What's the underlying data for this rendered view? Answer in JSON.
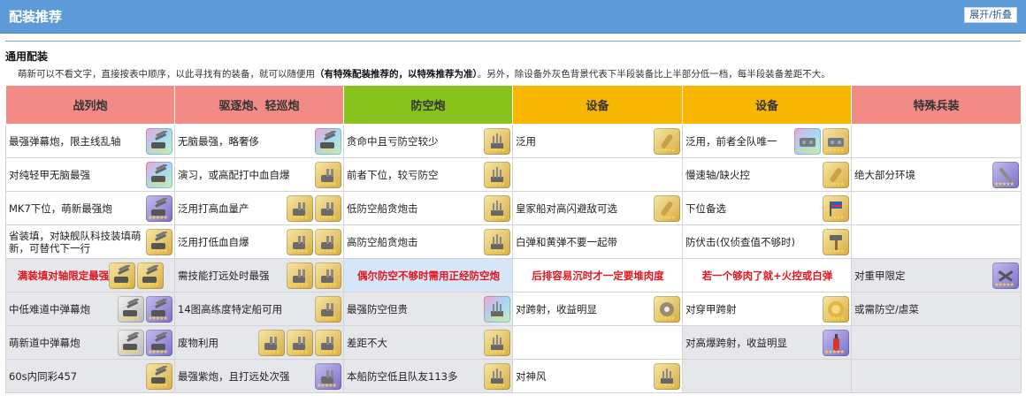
{
  "header": {
    "title": "配装推荐",
    "toggle_label": "展开/折叠"
  },
  "section": {
    "title": "通用配装",
    "notice_prefix": "萌新可以不看文字，直接按表中顺序，以此寻找有的装备，就可以随便用",
    "notice_bold": "（有特殊配装推荐的，以特殊推荐为准）",
    "notice_suffix": "。另外，除设备外灰色背景代表下半段装备比上半部分低一档，每半段装备差距不大。"
  },
  "columns": [
    "战列炮",
    "驱逐炮、轻巡炮",
    "防空炮",
    "设备",
    "设备",
    "特殊兵装"
  ],
  "colors": {
    "header_bar": "#5d9bd8",
    "red_head": "#f28b86",
    "green_head": "#87c21d",
    "orange_head": "#f7b600",
    "highlight_text": "#e0161e",
    "lower_rows": "#e6e7ea"
  },
  "rows": [
    {
      "cells": [
        {
          "text": "最强弹幕炮，限主线乱轴",
          "icons": [
            {
              "name": "heavy-gun-icon",
              "tier": "rainbow"
            }
          ]
        },
        {
          "text": "无脑最强，略奢侈",
          "icons": [
            {
              "name": "heavy-gun-icon",
              "tier": "rainbow"
            }
          ]
        },
        {
          "text": "贪命中且亏防空较少",
          "icons": [
            {
              "name": "aa-gun-icon",
              "tier": "gold"
            }
          ]
        },
        {
          "text": "泛用",
          "icons": [
            {
              "name": "shell-icon",
              "tier": "gold"
            }
          ]
        },
        {
          "text": "泛用，前者全队唯一",
          "icons": [
            {
              "name": "machine-icon",
              "tier": "rainbow"
            },
            {
              "name": "machine-icon",
              "tier": "gold"
            }
          ]
        },
        {
          "text": "",
          "icons": []
        }
      ]
    },
    {
      "cells": [
        {
          "text": "对纯轻甲无脑最强",
          "icons": [
            {
              "name": "heavy-gun-icon",
              "tier": "rainbow"
            }
          ]
        },
        {
          "text": "演习，或高配打中血自爆",
          "icons": [
            {
              "name": "gun-turret-icon",
              "tier": "gold"
            }
          ]
        },
        {
          "text": "前者下位，较亏防空",
          "icons": [
            {
              "name": "aa-gun-icon",
              "tier": "gold"
            }
          ]
        },
        {
          "text": "",
          "icons": []
        },
        {
          "text": "慢速轴/缺火控",
          "icons": [
            {
              "name": "shell-icon",
              "tier": "gold"
            }
          ]
        },
        {
          "text": "绝大部分环境",
          "icons": [
            {
              "name": "torpedo-icon",
              "tier": "purple"
            }
          ]
        }
      ]
    },
    {
      "cells": [
        {
          "text": "MK7下位，萌新最强炮",
          "icons": [
            {
              "name": "heavy-gun-icon",
              "tier": "purple"
            }
          ]
        },
        {
          "text": "泛用打高血量产",
          "icons": [
            {
              "name": "gun-turret-icon",
              "tier": "gold"
            },
            {
              "name": "gun-turret-icon",
              "tier": "gold"
            }
          ]
        },
        {
          "text": "低防空船贪炮击",
          "icons": [
            {
              "name": "aa-gun-icon",
              "tier": "gold"
            }
          ]
        },
        {
          "text": "皇家船对高闪避敌可选",
          "icons": [
            {
              "name": "shell-icon",
              "tier": "gold"
            }
          ]
        },
        {
          "text": "下位备选",
          "icons": [
            {
              "name": "flag-icon",
              "tier": "gold"
            }
          ]
        },
        {
          "text": "",
          "icons": []
        }
      ]
    },
    {
      "cells": [
        {
          "text": "省装填，对缺舰队科技装填萌新，可替代下一行",
          "icons": [
            {
              "name": "heavy-gun-icon",
              "tier": "gold"
            }
          ]
        },
        {
          "text": "泛用打低血自爆",
          "icons": [
            {
              "name": "gun-turret-icon",
              "tier": "gold"
            },
            {
              "name": "gun-turret-icon",
              "tier": "gold"
            }
          ]
        },
        {
          "text": "高防空船贪炮击",
          "icons": [
            {
              "name": "aa-gun-icon",
              "tier": "gold"
            }
          ]
        },
        {
          "text": "白弹和黄弹不要一起带",
          "icons": []
        },
        {
          "text": "防伏击(仅侦查值不够时)",
          "icons": [
            {
              "name": "hammer-icon",
              "tier": "gold"
            }
          ]
        },
        {
          "text": "",
          "icons": []
        }
      ]
    },
    {
      "cells": [
        {
          "text": "满装填对轴限定最强",
          "red": true,
          "icons": [
            {
              "name": "heavy-gun-icon",
              "tier": "gold"
            },
            {
              "name": "heavy-gun-icon",
              "tier": "gold"
            }
          ]
        },
        {
          "text": "需技能打远处时最强",
          "icons": [
            {
              "name": "gun-turret-icon",
              "tier": "gold"
            },
            {
              "name": "gun-turret-icon",
              "tier": "gold"
            }
          ]
        },
        {
          "text": "偶尔防空不够时需用正经防空炮",
          "red": true,
          "icons": []
        },
        {
          "text": "后排容易沉时才一定要堆肉度",
          "red": true,
          "icons": []
        },
        {
          "text": "若一个够肉了就+火控或白弹",
          "red": true,
          "icons": []
        },
        {
          "text": "对重甲限定",
          "icons": [
            {
              "name": "plane-icon",
              "tier": "purple"
            }
          ]
        }
      ]
    },
    {
      "cells": [
        {
          "text": "中低难道中弹幕炮",
          "icons": [
            {
              "name": "heavy-gun-icon",
              "tier": "silver"
            },
            {
              "name": "heavy-gun-icon",
              "tier": "purple"
            }
          ]
        },
        {
          "text": "14图高练度特定船可用",
          "icons": [
            {
              "name": "gun-turret-icon",
              "tier": "gold"
            }
          ]
        },
        {
          "text": "最强防空但贵",
          "icons": [
            {
              "name": "aa-gun-icon",
              "tier": "rainbow"
            }
          ]
        },
        {
          "text": "对跨射，收益明显",
          "icons": [
            {
              "name": "gear-icon",
              "tier": "gold"
            }
          ]
        },
        {
          "text": "对穿甲跨射",
          "icons": [
            {
              "name": "medal-icon",
              "tier": "gold"
            }
          ]
        },
        {
          "text": "或需防空/虐菜",
          "icons": []
        }
      ]
    },
    {
      "cells": [
        {
          "text": "萌新道中弹幕炮",
          "icons": [
            {
              "name": "heavy-gun-icon",
              "tier": "silver"
            },
            {
              "name": "heavy-gun-icon",
              "tier": "purple"
            }
          ]
        },
        {
          "text": "废物利用",
          "icons": [
            {
              "name": "gun-turret-icon",
              "tier": "gold"
            },
            {
              "name": "gun-turret-icon",
              "tier": "gold"
            },
            {
              "name": "gun-turret-icon",
              "tier": "gold"
            }
          ]
        },
        {
          "text": "差距不大",
          "icons": [
            {
              "name": "aa-gun-icon",
              "tier": "gold"
            }
          ]
        },
        {
          "text": "",
          "icons": []
        },
        {
          "text": "对高爆跨射，收益明显",
          "icons": [
            {
              "name": "extinguisher-icon",
              "tier": "purple"
            }
          ]
        },
        {
          "text": "",
          "icons": []
        }
      ]
    },
    {
      "cells": [
        {
          "text": "60s内同彩457",
          "icons": [
            {
              "name": "heavy-gun-icon",
              "tier": "gold"
            }
          ]
        },
        {
          "text": "最强紫炮，且打远处次强",
          "icons": [
            {
              "name": "gun-turret-icon",
              "tier": "purple"
            }
          ]
        },
        {
          "text": "本船防空低且队友113多",
          "icons": [
            {
              "name": "aa-gun-icon",
              "tier": "gold"
            }
          ]
        },
        {
          "text": "对神风",
          "icons": [
            {
              "name": "aa-gun-icon",
              "tier": "gold"
            }
          ]
        },
        {
          "text": "",
          "icons": []
        },
        {
          "text": "",
          "icons": []
        }
      ]
    }
  ]
}
